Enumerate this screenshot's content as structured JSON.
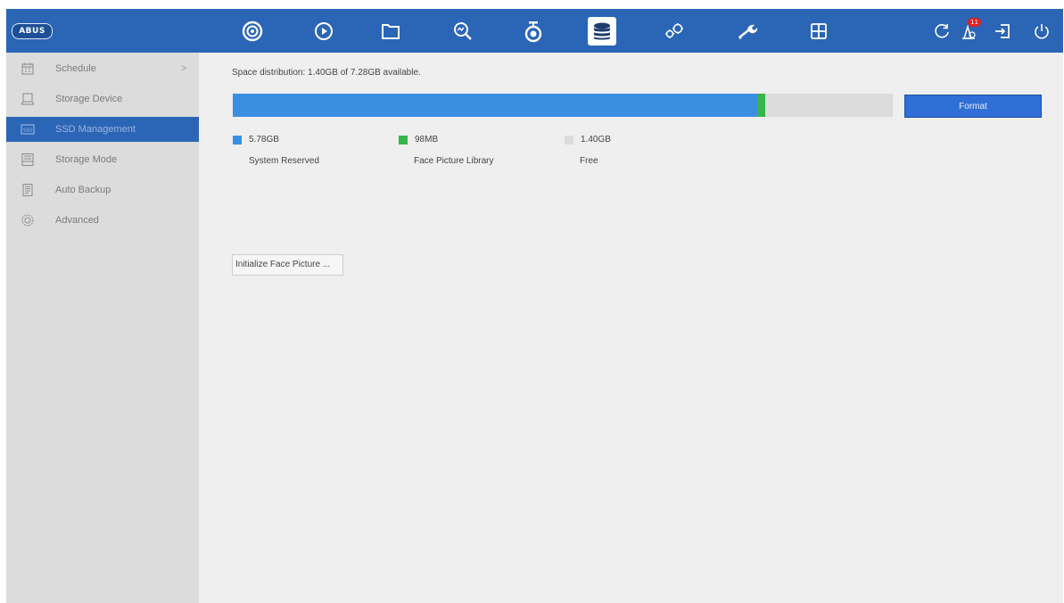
{
  "brand": {
    "logo_text": "ABUS"
  },
  "topnav": [
    {
      "icon": "camera-icon",
      "active": false
    },
    {
      "icon": "play-icon",
      "active": false
    },
    {
      "icon": "folder-icon",
      "active": false
    },
    {
      "icon": "search-icon",
      "active": false
    },
    {
      "icon": "surveillance-camera-icon",
      "active": false
    },
    {
      "icon": "storage-database-icon",
      "active": true
    },
    {
      "icon": "system-config-icon",
      "active": false
    },
    {
      "icon": "maintenance-wrench-icon",
      "active": false
    },
    {
      "icon": "grid-layout-icon",
      "active": false
    }
  ],
  "toprightnav": {
    "refresh_icon": "refresh-icon",
    "alarm_icon": "alarm-icon",
    "alarm_badge": "11",
    "logout_icon": "logout-icon",
    "power_icon": "power-icon"
  },
  "sidebar": {
    "items": [
      {
        "label": "Schedule",
        "icon": "schedule-icon",
        "has_submenu": true
      },
      {
        "label": "Storage Device",
        "icon": "storage-device-icon"
      },
      {
        "label": "SSD Management",
        "icon": "ssd-icon",
        "active": true
      },
      {
        "label": "Storage Mode",
        "icon": "storage-mode-icon"
      },
      {
        "label": "Auto Backup",
        "icon": "backup-icon"
      },
      {
        "label": "Advanced",
        "icon": "advanced-gear-icon"
      }
    ],
    "chevron": ">"
  },
  "main": {
    "space_distribution": "Space distribution: 1.40GB of 7.28GB available.",
    "usage": {
      "blue_fraction": 0.794,
      "green_fraction": 0.013
    },
    "format_label": "Format",
    "legend": [
      {
        "value": "5.78GB",
        "name": "System Reserved",
        "color": "#3a8fe3"
      },
      {
        "value": "98MB",
        "name": "Face Picture Library",
        "color": "#36b54a"
      },
      {
        "value": "1.40GB",
        "name": "Free",
        "color": "#dcdcdc"
      }
    ],
    "initialize_label": "Initialize Face Picture ..."
  },
  "colors": {
    "topbar": "#2b65b6",
    "active_item": "#2b65b6",
    "sidebar_bg": "#dcdcdc"
  }
}
